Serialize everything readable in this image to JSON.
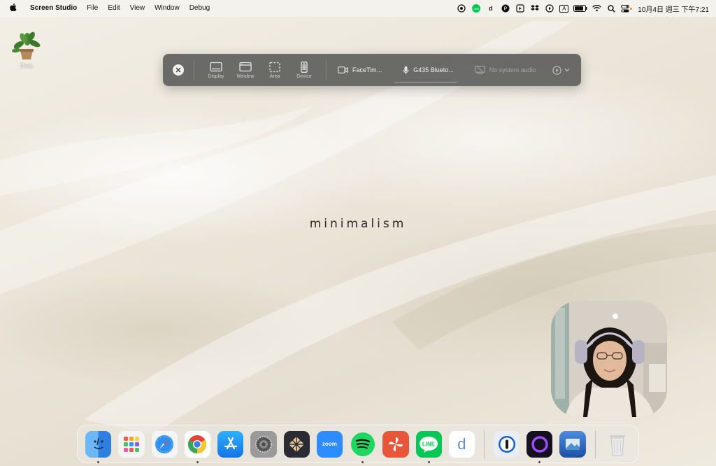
{
  "menubar": {
    "apple_icon": "apple-icon",
    "app_name": "Screen Studio",
    "menus": [
      "File",
      "Edit",
      "View",
      "Window",
      "Debug"
    ],
    "status_icons": [
      "privacy-icon",
      "line-icon",
      "d-icon",
      "pocket-icon",
      "cursor-icon",
      "dropbox-icon",
      "play-icon",
      "input-a-icon",
      "battery-icon",
      "wifi-icon",
      "search-icon",
      "control-center-icon"
    ],
    "input_label": "A",
    "clock": "10月4日 週三  下午7:21"
  },
  "desktop": {
    "icon_label": "Desk",
    "wallpaper_text": "minimalism"
  },
  "toolbar": {
    "modes": [
      {
        "label": "Display",
        "icon": "display-icon"
      },
      {
        "label": "Window",
        "icon": "window-icon"
      },
      {
        "label": "Area",
        "icon": "area-icon"
      },
      {
        "label": "Device",
        "icon": "device-icon"
      }
    ],
    "camera": "FaceTim...",
    "microphone": "G435 Blueto...",
    "system_audio": "No system audio"
  },
  "dock": {
    "apps": [
      {
        "name": "Finder",
        "running": true,
        "color": "#3d8fe6"
      },
      {
        "name": "Launchpad",
        "running": false,
        "color": "#f2f2f2"
      },
      {
        "name": "Safari",
        "running": false,
        "color": "#eef3fb"
      },
      {
        "name": "Chrome",
        "running": true,
        "color": "#ffffff"
      },
      {
        "name": "App Store",
        "running": false,
        "color": "#1e8cf0"
      },
      {
        "name": "System Settings",
        "running": false,
        "color": "#8a8a8a"
      },
      {
        "name": "Notchmeister",
        "running": false,
        "color": "#2b2b33"
      },
      {
        "name": "zoom",
        "running": false,
        "color": "#2d8cff"
      },
      {
        "name": "Spotify",
        "running": true,
        "color": "#1ed760"
      },
      {
        "name": "Pinwheel",
        "running": false,
        "color": "#e8563a"
      },
      {
        "name": "LINE",
        "running": true,
        "color": "#06c755"
      },
      {
        "name": "d",
        "running": false,
        "color": "#ffffff"
      },
      {
        "name": "1Password",
        "running": false,
        "color": "#e9eef6"
      },
      {
        "name": "Screen Studio",
        "running": true,
        "color": "#1a1033"
      },
      {
        "name": "Preview",
        "running": false,
        "color": "#2a5aa8"
      },
      {
        "name": "Trash",
        "running": false,
        "color": "#e5e5e5"
      }
    ]
  }
}
